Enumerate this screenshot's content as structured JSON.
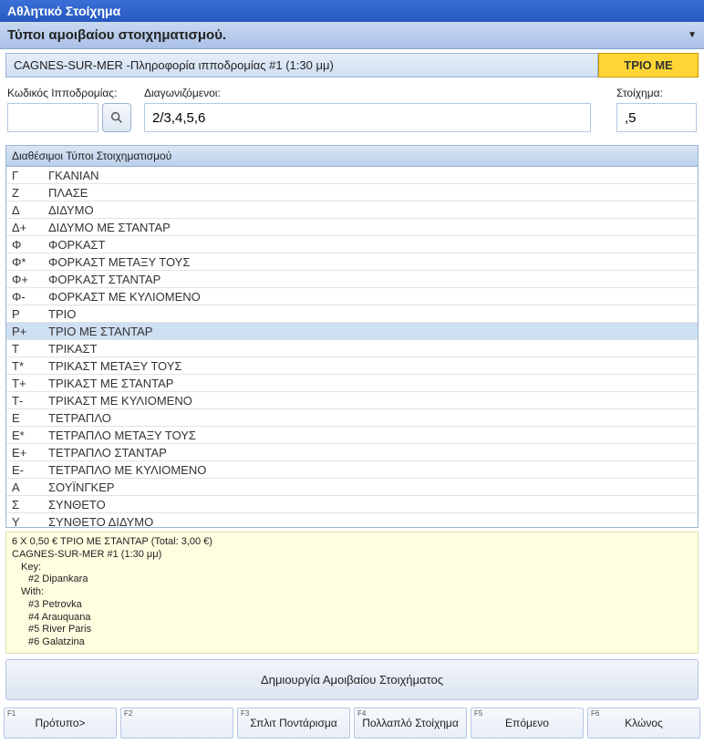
{
  "title": "Αθλητικό Στοίχημα",
  "subtitle": "Τύποι αμοιβαίου στοιχηματισμού.",
  "raceInfo": "CAGNES-SUR-MER -Πληροφορία ιπποδρομίας #1 (1:30 μμ)",
  "betBadge": "ΤΡΙΟ ΜΕ",
  "labels": {
    "code": "Κωδικός Ιπποδρομίας:",
    "runners": "Διαγωνιζόμενοι:",
    "stake": "Στοίχημα:"
  },
  "inputs": {
    "code": "",
    "runners": "2/3,4,5,6",
    "stake": ",5"
  },
  "tableHeader": "Διαθέσιμοι Τύποι Στοιχηματισμού",
  "betTypes": [
    {
      "code": "Γ",
      "name": "ΓΚΑΝΙΑΝ"
    },
    {
      "code": "Z",
      "name": "ΠΛΑΣΕ"
    },
    {
      "code": "Δ",
      "name": "ΔΙΔΥΜΟ"
    },
    {
      "code": "Δ+",
      "name": "ΔΙΔΥΜΟ ΜΕ ΣΤΑΝΤΑΡ"
    },
    {
      "code": "Φ",
      "name": "ΦΟΡΚΑΣΤ"
    },
    {
      "code": "Φ*",
      "name": "ΦΟΡΚΑΣΤ ΜΕΤΑΞΥ ΤΟΥΣ"
    },
    {
      "code": "Φ+",
      "name": "ΦΟΡΚΑΣΤ ΣΤΑΝΤΑΡ"
    },
    {
      "code": "Φ-",
      "name": "ΦΟΡΚΑΣΤ ΜΕ ΚΥΛΙΟΜΕΝΟ"
    },
    {
      "code": "Ρ",
      "name": "ΤΡΙΟ"
    },
    {
      "code": "Ρ+",
      "name": "ΤΡΙΟ ΜΕ ΣΤΑΝΤΑΡ",
      "selected": true
    },
    {
      "code": "Τ",
      "name": "ΤΡΙΚΑΣΤ"
    },
    {
      "code": "Τ*",
      "name": "ΤΡΙΚΑΣΤ ΜΕΤΑΞΥ ΤΟΥΣ"
    },
    {
      "code": "Τ+",
      "name": "ΤΡΙΚΑΣΤ ΜΕ ΣΤΑΝΤΑΡ"
    },
    {
      "code": "Τ-",
      "name": "ΤΡΙΚΑΣΤ ΜΕ ΚΥΛΙΟΜΕΝΟ"
    },
    {
      "code": "Ε",
      "name": "ΤΕΤΡΑΠΛΟ"
    },
    {
      "code": "Ε*",
      "name": "ΤΕΤΡΑΠΛΟ ΜΕΤΑΞΥ ΤΟΥΣ"
    },
    {
      "code": "Ε+",
      "name": "ΤΕΤΡΑΠΛΟ ΣΤΑΝΤΑΡ"
    },
    {
      "code": "Ε-",
      "name": "ΤΕΤΡΑΠΛΟ ΜΕ ΚΥΛΙΟΜΕΝΟ"
    },
    {
      "code": "Α",
      "name": "ΣΟΥΪΝΓΚΕΡ"
    },
    {
      "code": "Σ",
      "name": "ΣΥΝΘΕΤΟ"
    },
    {
      "code": "Υ",
      "name": "ΣΥΝΘΕΤΟ ΔΙΔΥΜΟ"
    }
  ],
  "summary": {
    "line1": "6 Χ 0,50 € ΤΡΙΟ ΜΕ ΣΤΑΝΤΑΡ (Total: 3,00 €)",
    "line2": "CAGNES-SUR-MER #1 (1:30 μμ)",
    "keyLabel": "Key:",
    "keyHorse": "#2 Dipankara",
    "withLabel": "With:",
    "withHorses": [
      "#3 Petrovka",
      "#4 Arauquana",
      "#5 River Paris",
      "#6 Galatzina"
    ]
  },
  "createBtn": "Δημιουργία Αμοιβαίου Στοιχήματος",
  "fkeys": [
    {
      "fn": "F1",
      "label": "Πρότυπο>"
    },
    {
      "fn": "F2",
      "label": ""
    },
    {
      "fn": "F3",
      "label": "Σπλιτ Ποντάρισμα"
    },
    {
      "fn": "F4",
      "label": "Πολλαπλό Στοίχημα"
    },
    {
      "fn": "F5",
      "label": "Επόμενο"
    },
    {
      "fn": "F6",
      "label": "Κλώνος"
    }
  ]
}
